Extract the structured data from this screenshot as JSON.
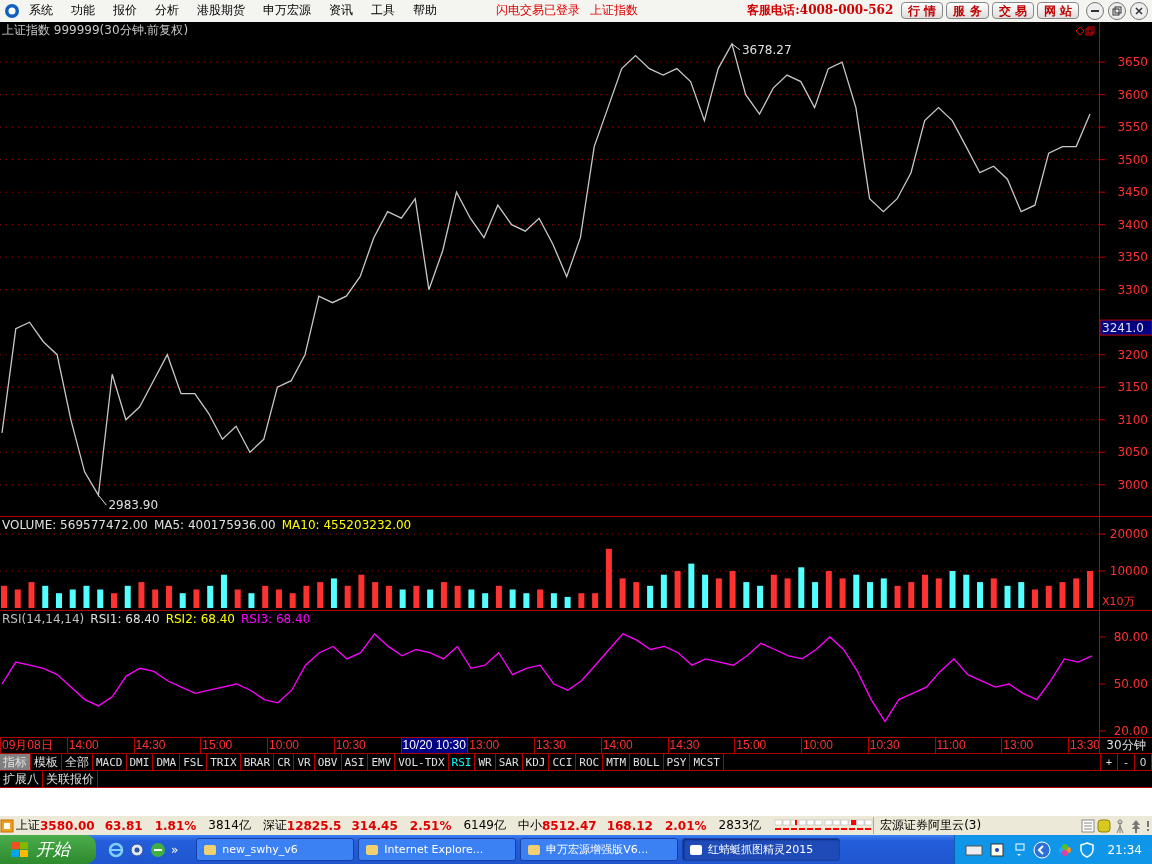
{
  "menu_bar": {
    "items": [
      "系统",
      "功能",
      "报价",
      "分析",
      "港股期货",
      "申万宏源",
      "资讯",
      "工具",
      "帮助"
    ],
    "notices": [
      "闪电交易已登录",
      "上证指数"
    ],
    "hotline": "客服电话:4008-000-562",
    "buttons": [
      "行 情",
      "服 务",
      "交 易",
      "网 站"
    ]
  },
  "chart_title": "上证指数 999999(30分钟.前复权)",
  "price_pane": {
    "current_price": "3241.0",
    "markers": [
      {
        "label": "3678.27",
        "kind": "high"
      },
      {
        "label": "2983.90",
        "kind": "low"
      }
    ],
    "chart_data": {
      "type": "line",
      "grid": true,
      "ylim": [
        2952,
        3684
      ],
      "yticks": [
        3000,
        3050,
        3100,
        3150,
        3200,
        3300,
        3350,
        3400,
        3450,
        3500,
        3550,
        3600,
        3650
      ],
      "series": [
        {
          "color": "#c8c8c8",
          "values": [
            3080,
            3240,
            3250,
            3220,
            3200,
            3100,
            3020,
            2984,
            3170,
            3100,
            3120,
            3160,
            3200,
            3140,
            3140,
            3110,
            3070,
            3090,
            3050,
            3070,
            3150,
            3160,
            3200,
            3290,
            3280,
            3290,
            3320,
            3380,
            3420,
            3410,
            3440,
            3300,
            3360,
            3450,
            3410,
            3380,
            3430,
            3400,
            3390,
            3410,
            3370,
            3320,
            3380,
            3520,
            3580,
            3640,
            3660,
            3640,
            3630,
            3640,
            3620,
            3560,
            3640,
            3678,
            3600,
            3570,
            3610,
            3630,
            3620,
            3580,
            3640,
            3650,
            3580,
            3440,
            3420,
            3440,
            3480,
            3560,
            3580,
            3560,
            3520,
            3480,
            3490,
            3470,
            3420,
            3430,
            3510,
            3520,
            3520,
            3570
          ]
        }
      ]
    }
  },
  "volume_pane": {
    "legend": [
      {
        "text": "VOLUME: 569577472.00",
        "color": "#e0e0e0"
      },
      {
        "text": "MA5: 400175936.00",
        "color": "#e0e0e0"
      },
      {
        "text": "MA10: 455203232.00",
        "color": "#ffff00"
      }
    ],
    "unit": "X10万",
    "chart_data": {
      "type": "bar",
      "grid": true,
      "ylim": [
        0,
        24600
      ],
      "yticks": [
        10000,
        20000
      ],
      "series": [
        {
          "color": "#ff3232",
          "values": [
            6000,
            5000,
            7000,
            null,
            null,
            null,
            null,
            null,
            4000,
            null,
            7000,
            5000,
            6000,
            null,
            5000,
            null,
            null,
            5000,
            null,
            6000,
            5000,
            4000,
            6000,
            7000,
            null,
            6000,
            9000,
            7000,
            6000,
            null,
            6000,
            null,
            7000,
            6000,
            null,
            null,
            6000,
            null,
            null,
            5000,
            null,
            null,
            4000,
            4000,
            16000,
            8000,
            7000,
            null,
            null,
            10000,
            null,
            null,
            8000,
            10000,
            null,
            null,
            9000,
            8000,
            null,
            null,
            10000,
            8000,
            null,
            null,
            null,
            6000,
            7000,
            9000,
            8000,
            null,
            null,
            null,
            8000,
            null,
            null,
            5000,
            6000,
            7000,
            8000,
            10000
          ]
        },
        {
          "color": "#54ffff",
          "values": [
            null,
            null,
            null,
            6000,
            4000,
            5000,
            6000,
            5000,
            null,
            6000,
            null,
            null,
            null,
            4000,
            null,
            6000,
            9000,
            null,
            4000,
            null,
            null,
            null,
            null,
            null,
            8000,
            null,
            null,
            null,
            null,
            5000,
            null,
            5000,
            null,
            null,
            5000,
            4000,
            null,
            5000,
            4000,
            null,
            4000,
            3000,
            null,
            null,
            null,
            null,
            null,
            6000,
            9000,
            null,
            12000,
            9000,
            null,
            null,
            7000,
            6000,
            null,
            null,
            11000,
            7000,
            null,
            null,
            9000,
            7000,
            8000,
            null,
            null,
            null,
            null,
            10000,
            9000,
            7000,
            null,
            6000,
            7000,
            null,
            null,
            null,
            null,
            null
          ]
        }
      ]
    }
  },
  "rsi_pane": {
    "legend": [
      {
        "text": "RSI(14,14,14)",
        "color": "#c0c0c0"
      },
      {
        "text": "RSI1: 68.40",
        "color": "#e0e0e0"
      },
      {
        "text": "RSI2: 68.40",
        "color": "#ffff00"
      },
      {
        "text": "RSI3: 68.40",
        "color": "#ff00ff"
      }
    ],
    "chart_data": {
      "type": "line",
      "ylim": [
        15.5,
        96.6
      ],
      "yticks": [
        {
          "value": 20,
          "label": "20.00"
        },
        {
          "value": 50,
          "label": "50.00"
        },
        {
          "value": 80,
          "label": "80.00"
        }
      ],
      "series": [
        {
          "color": "#ff00ff",
          "values": [
            50,
            64,
            62,
            60,
            56,
            48,
            40,
            36,
            42,
            55,
            60,
            58,
            52,
            48,
            44,
            46,
            48,
            50,
            46,
            40,
            38,
            46,
            62,
            70,
            74,
            66,
            70,
            82,
            74,
            68,
            72,
            70,
            66,
            74,
            60,
            62,
            70,
            56,
            60,
            62,
            50,
            46,
            52,
            62,
            72,
            82,
            78,
            72,
            74,
            70,
            62,
            66,
            64,
            62,
            68,
            76,
            72,
            68,
            66,
            72,
            80,
            72,
            58,
            40,
            26,
            40,
            44,
            48,
            58,
            66,
            56,
            52,
            48,
            50,
            44,
            40,
            52,
            66,
            64,
            68
          ]
        }
      ]
    }
  },
  "time_axis": {
    "labels": [
      {
        "text": "09月08日",
        "selected": false
      },
      {
        "text": "14:00",
        "selected": false
      },
      {
        "text": "14:30",
        "selected": false
      },
      {
        "text": "15:00",
        "selected": false
      },
      {
        "text": "10:00",
        "selected": false
      },
      {
        "text": "10:30",
        "selected": false
      },
      {
        "text": "10/20 10:30",
        "selected": true
      },
      {
        "text": "13:00",
        "selected": false
      },
      {
        "text": "13:30",
        "selected": false
      },
      {
        "text": "14:00",
        "selected": false
      },
      {
        "text": "14:30",
        "selected": false
      },
      {
        "text": "15:00",
        "selected": false
      },
      {
        "text": "10:00",
        "selected": false
      },
      {
        "text": "10:30",
        "selected": false
      },
      {
        "text": "11:00",
        "selected": false
      },
      {
        "text": "13:00",
        "selected": false
      },
      {
        "text": "13:30",
        "selected": false
      }
    ],
    "period": "30分钟"
  },
  "indicator_tabs": [
    {
      "label": "指标",
      "kind": "mode",
      "selected": true
    },
    {
      "label": "模板",
      "kind": "mode",
      "selected": false
    },
    {
      "label": "全部",
      "kind": "mode",
      "selected": false
    },
    {
      "label": "MACD",
      "kind": "indicator",
      "selected": false
    },
    {
      "label": "DMI",
      "kind": "indicator",
      "selected": false
    },
    {
      "label": "DMA",
      "kind": "indicator",
      "selected": false
    },
    {
      "label": "FSL",
      "kind": "indicator",
      "selected": false
    },
    {
      "label": "TRIX",
      "kind": "indicator",
      "selected": false
    },
    {
      "label": "BRAR",
      "kind": "indicator",
      "selected": false
    },
    {
      "label": "CR",
      "kind": "indicator",
      "selected": false
    },
    {
      "label": "VR",
      "kind": "indicator",
      "selected": false
    },
    {
      "label": "OBV",
      "kind": "indicator",
      "selected": false
    },
    {
      "label": "ASI",
      "kind": "indicator",
      "selected": false
    },
    {
      "label": "EMV",
      "kind": "indicator",
      "selected": false
    },
    {
      "label": "VOL-TDX",
      "kind": "indicator",
      "selected": false
    },
    {
      "label": "RSI",
      "kind": "indicator",
      "selected": true
    },
    {
      "label": "WR",
      "kind": "indicator",
      "selected": false
    },
    {
      "label": "SAR",
      "kind": "indicator",
      "selected": false
    },
    {
      "label": "KDJ",
      "kind": "indicator",
      "selected": false
    },
    {
      "label": "CCI",
      "kind": "indicator",
      "selected": false
    },
    {
      "label": "ROC",
      "kind": "indicator",
      "selected": false
    },
    {
      "label": "MTM",
      "kind": "indicator",
      "selected": false
    },
    {
      "label": "BOLL",
      "kind": "indicator",
      "selected": false
    },
    {
      "label": "PSY",
      "kind": "indicator",
      "selected": false
    },
    {
      "label": "MCST",
      "kind": "indicator",
      "selected": false
    }
  ],
  "zoom_buttons": [
    "+",
    "-",
    "0"
  ],
  "extra_tabs": [
    "扩展八",
    "关联报价"
  ],
  "status_bar": {
    "indices": [
      {
        "name": "上证",
        "price": "3580.00",
        "change": "63.81",
        "percent": "1.81%",
        "amount": "3814亿"
      },
      {
        "name": "深证",
        "price": "12825.5",
        "change": "314.45",
        "percent": "2.51%",
        "amount": "6149亿"
      },
      {
        "name": "中小",
        "price": "8512.47",
        "change": "168.12",
        "percent": "2.01%",
        "amount": "2833亿"
      }
    ],
    "server": "宏源证券阿里云(3)"
  },
  "taskbar": {
    "start": "开始",
    "more": "»",
    "tasks": [
      {
        "label": "new_swhy_v6",
        "selected": false
      },
      {
        "label": "Internet Explore...",
        "selected": false
      },
      {
        "label": "申万宏源增强版V6...",
        "selected": false
      },
      {
        "label": "红蜻蜓抓图精灵2015",
        "selected": true
      }
    ],
    "clock": "21:34"
  }
}
